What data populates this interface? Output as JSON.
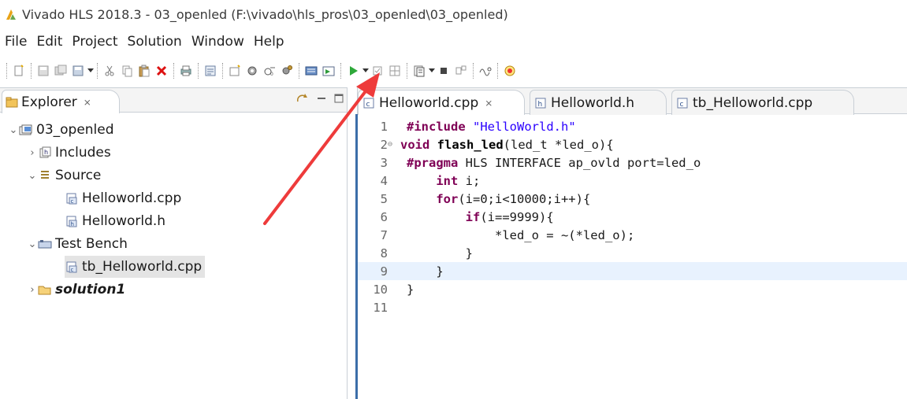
{
  "window": {
    "title": "Vivado HLS 2018.3 - 03_openled (F:\\vivado\\hls_pros\\03_openled\\03_openled)"
  },
  "menu": [
    "File",
    "Edit",
    "Project",
    "Solution",
    "Window",
    "Help"
  ],
  "explorer": {
    "tab_label": "Explorer",
    "tab_close": "⨯",
    "tree": [
      {
        "label": "03_openled",
        "level": 0,
        "expanded": true,
        "icon": "project-icon"
      },
      {
        "label": "Includes",
        "level": 1,
        "expanded": false,
        "icon": "includes-icon"
      },
      {
        "label": "Source",
        "level": 1,
        "expanded": true,
        "icon": "source-icon"
      },
      {
        "label": "Helloworld.cpp",
        "level": 2,
        "icon": "cpp-file-icon"
      },
      {
        "label": "Helloworld.h",
        "level": 2,
        "icon": "h-file-icon"
      },
      {
        "label": "Test Bench",
        "level": 1,
        "expanded": true,
        "icon": "testbench-icon"
      },
      {
        "label": "tb_Helloworld.cpp",
        "level": 2,
        "icon": "cpp-file-icon",
        "selected": true
      },
      {
        "label": "solution1",
        "level": 1,
        "expanded": false,
        "icon": "solution-folder-icon"
      }
    ]
  },
  "editor": {
    "tabs": [
      {
        "label": "Helloworld.cpp",
        "active": true,
        "close": "⨯"
      },
      {
        "label": "Helloworld.h",
        "active": false
      },
      {
        "label": "tb_Helloworld.cpp",
        "active": false
      }
    ],
    "current_line": 9,
    "lines": [
      {
        "n": "1",
        "text": "#include \"HelloWorld.h\""
      },
      {
        "n": "2",
        "text": "void flash_led(led_t *led_o){",
        "fold": true
      },
      {
        "n": "3",
        "text": "#pragma HLS INTERFACE ap_ovld port=led_o"
      },
      {
        "n": "4",
        "text": "    int i;"
      },
      {
        "n": "5",
        "text": "    for(i=0;i<10000;i++){"
      },
      {
        "n": "6",
        "text": "        if(i==9999){"
      },
      {
        "n": "7",
        "text": "            *led_o = ~(*led_o);"
      },
      {
        "n": "8",
        "text": "        }"
      },
      {
        "n": "9",
        "text": "    }"
      },
      {
        "n": "10",
        "text": "}"
      },
      {
        "n": "11",
        "text": ""
      }
    ]
  },
  "colors": {
    "keyword": "#7f0055",
    "string": "#2a00ff",
    "annotation_arrow": "#ee3b3b",
    "current_line": "#e8f2fe"
  }
}
